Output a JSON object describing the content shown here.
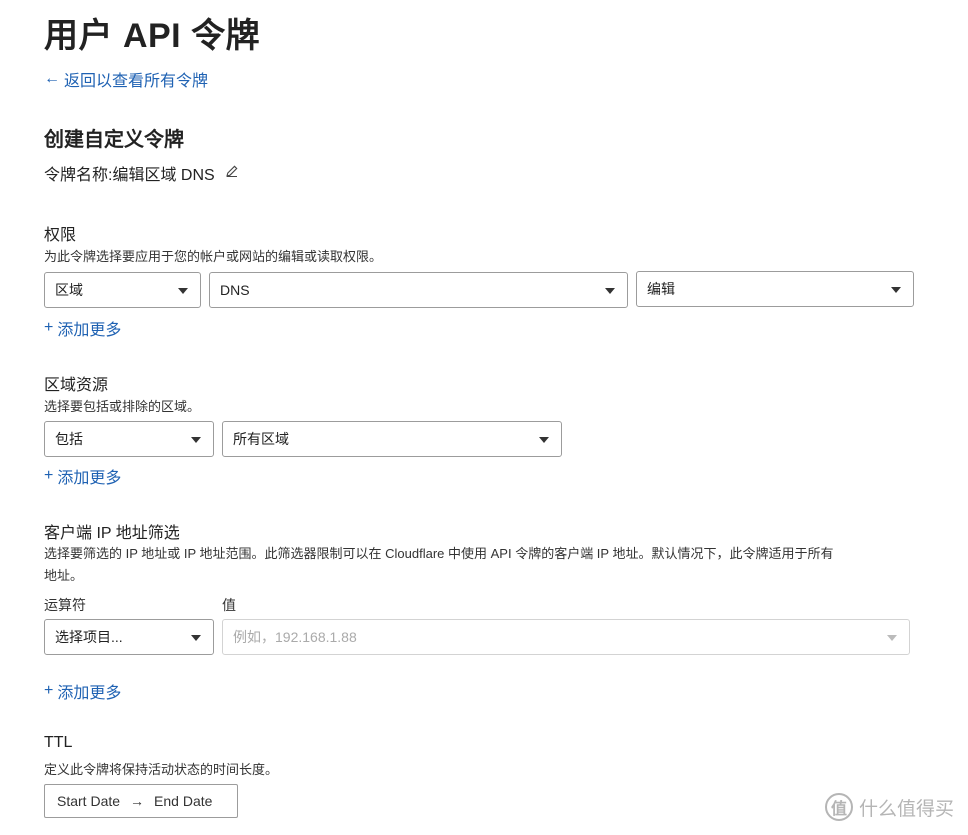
{
  "page": {
    "title": "用户 API 令牌",
    "back_link": "返回以查看所有令牌"
  },
  "form": {
    "section_title": "创建自定义令牌",
    "token_name_label": "令牌名称: ",
    "token_name_value": "编辑区域 DNS"
  },
  "permissions": {
    "title": "权限",
    "description": "为此令牌选择要应用于您的帐户或网站的编辑或读取权限。",
    "selects": [
      "区域",
      "DNS",
      "编辑"
    ],
    "add_more": "添加更多"
  },
  "zone_resources": {
    "title": "区域资源",
    "description": "选择要包括或排除的区域。",
    "selects": [
      "包括",
      "所有区域"
    ],
    "add_more": "添加更多"
  },
  "ip_filter": {
    "title": "客户端 IP 地址筛选",
    "description_line1": "选择要筛选的 IP 地址或 IP 地址范围。此筛选器限制可以在 Cloudflare 中使用 API 令牌的客户端 IP 地址。默认情况下，此令牌适用于所有",
    "description_line2": "地址。",
    "operator_label": "运算符",
    "value_label": "值",
    "operator_select": "选择项目...",
    "value_placeholder": "例如，192.168.1.88",
    "add_more": "添加更多"
  },
  "ttl": {
    "title": "TTL",
    "description": "定义此令牌将保持活动状态的时间长度。",
    "start_date": "Start Date",
    "end_date": "End Date"
  },
  "watermark": {
    "text": "什么值得买",
    "logo_char": "值"
  },
  "icons": {
    "back": "arrow-left-icon",
    "edit": "pencil-icon",
    "add": "plus-icon",
    "caret": "caret-down-icon",
    "date_arrow": "arrow-right-icon"
  },
  "colors": {
    "link": "#1f62b3",
    "border": "#9c9c9c"
  }
}
